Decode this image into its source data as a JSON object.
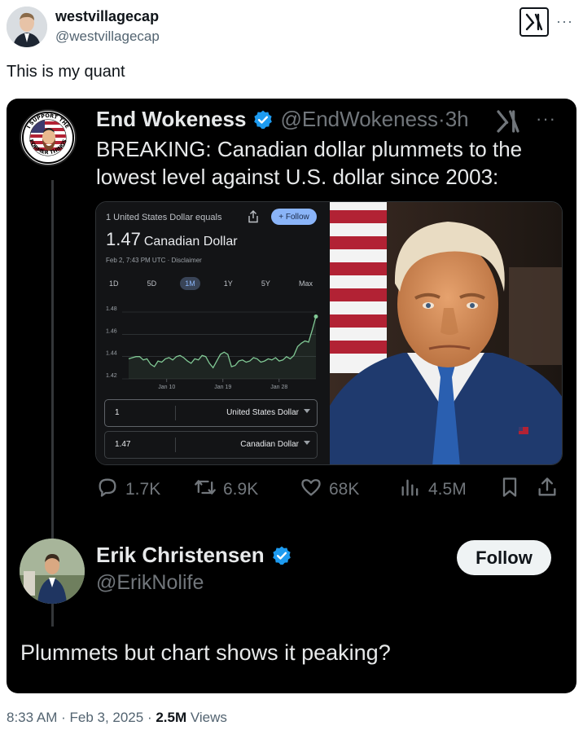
{
  "outer_tweet": {
    "display_name": "westvillagecap",
    "handle": "@westvillagecap",
    "text": "This is my quant",
    "more_label": "···"
  },
  "quoted_tweet": {
    "display_name": "End Wokeness",
    "handle": "@EndWokeness",
    "separator": "·",
    "time": "3h",
    "more_label": "···",
    "text": "BREAKING: Canadian dollar plummets to the lowest level against U.S. dollar since 2003:",
    "avatar_text": {
      "top": "I SUPPORT THE",
      "bottom": "FORMER THINGS"
    },
    "finance_widget": {
      "equals_label": "1 United States Dollar equals",
      "follow_label": "+ Follow",
      "value": "1.47",
      "unit": "Canadian Dollar",
      "date_line": "Feb 2, 7:43 PM UTC · Disclaimer",
      "ranges": [
        "1D",
        "5D",
        "1M",
        "1Y",
        "5Y",
        "Max"
      ],
      "active_range": "1M",
      "converter": [
        {
          "amount": "1",
          "currency": "United States Dollar"
        },
        {
          "amount": "1.47",
          "currency": "Canadian Dollar"
        }
      ]
    },
    "stats": {
      "replies": "1.7K",
      "reposts": "6.9K",
      "likes": "68K",
      "views": "4.5M"
    }
  },
  "reply": {
    "display_name": "Erik Christensen",
    "handle": "@ErikNolife",
    "follow_label": "Follow",
    "text": "Plummets but chart shows it peaking?"
  },
  "footer": {
    "timestamp": "8:33 AM · Feb 3, 2025 · ",
    "views_count": "2.5M",
    "views_label": " Views"
  },
  "colors": {
    "verified": "#1d9bf0",
    "chart_line": "#81c995",
    "card_bg": "#000000",
    "widget_bg": "#131416"
  },
  "icons": [
    "verified-badge-icon",
    "x-logo-icon",
    "share-icon",
    "reply-icon",
    "repost-icon",
    "like-icon",
    "views-icon",
    "bookmark-icon",
    "upload-icon"
  ],
  "chart_data": {
    "type": "line",
    "title": "",
    "x_ticks": [
      "Jan 10",
      "Jan 19",
      "Jan 28"
    ],
    "y_ticks": [
      1.42,
      1.44,
      1.46,
      1.48
    ],
    "ylim": [
      1.42,
      1.48
    ],
    "grid": true,
    "series": [
      {
        "values": [
          1.438,
          1.439,
          1.44,
          1.44,
          1.437,
          1.438,
          1.433,
          1.431,
          1.436,
          1.435,
          1.438,
          1.439,
          1.437,
          1.44,
          1.441,
          1.439,
          1.436,
          1.434,
          1.438,
          1.437,
          1.441,
          1.44,
          1.434,
          1.43,
          1.436,
          1.442,
          1.444,
          1.442,
          1.431,
          1.432,
          1.436,
          1.437,
          1.435,
          1.436,
          1.439,
          1.438,
          1.435,
          1.436,
          1.438,
          1.437,
          1.439,
          1.436,
          1.437,
          1.44,
          1.438,
          1.441,
          1.449,
          1.452,
          1.454,
          1.453,
          1.464,
          1.476
        ]
      }
    ]
  }
}
